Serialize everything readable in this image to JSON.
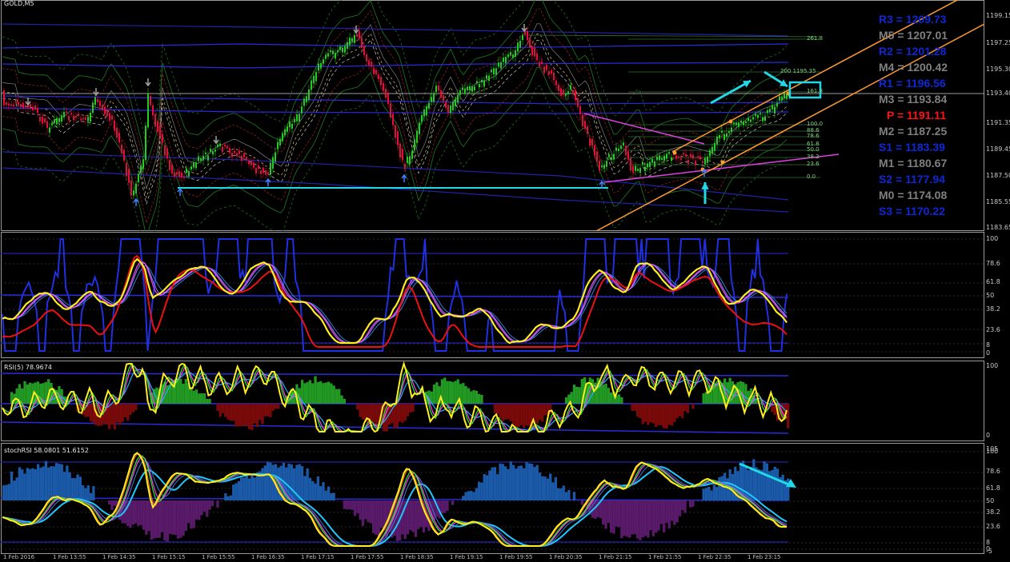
{
  "chart_title": "GOLD,M5",
  "main_panel": {
    "price_ticks": [
      "1199.15",
      "1197.25",
      "1195.30",
      "1193.40",
      "1191.35",
      "1189.45",
      "1187.50",
      "1185.55",
      "1183.65"
    ],
    "current_price": "1193.40",
    "fib_labels": [
      "261.8",
      "200  1195.35",
      "161.8",
      "100.0",
      "88.6",
      "78.6",
      "61.8",
      "50.0",
      "38.2",
      "23.6",
      "0.0"
    ]
  },
  "pivots": [
    {
      "key": "R3",
      "value": "1209.73",
      "kind": "R"
    },
    {
      "key": "M5",
      "value": "1207.01",
      "kind": "M"
    },
    {
      "key": "R2",
      "value": "1201.28",
      "kind": "R"
    },
    {
      "key": "M4",
      "value": "1200.42",
      "kind": "M"
    },
    {
      "key": "R1",
      "value": "1196.56",
      "kind": "R"
    },
    {
      "key": "M3",
      "value": "1193.84",
      "kind": "M"
    },
    {
      "key": "P",
      "value": "1191.11",
      "kind": "P"
    },
    {
      "key": "M2",
      "value": "1187.25",
      "kind": "M"
    },
    {
      "key": "S1",
      "value": "1183.39",
      "kind": "R"
    },
    {
      "key": "M1",
      "value": "1180.67",
      "kind": "M"
    },
    {
      "key": "S2",
      "value": "1177.94",
      "kind": "R"
    },
    {
      "key": "M0",
      "value": "1174.08",
      "kind": "M"
    },
    {
      "key": "S3",
      "value": "1170.22",
      "kind": "R"
    }
  ],
  "stoch_panel": {
    "ticks": [
      "100",
      "78.6",
      "61.8",
      "50",
      "38.2",
      "23.6",
      "8",
      "0"
    ]
  },
  "rsi_panel": {
    "label": "RSI(5) 78.9674",
    "ticks": [
      "100",
      "0"
    ]
  },
  "stochrsi_panel": {
    "label": "stochRSI 58.0801 51.6152",
    "ticks": [
      "105",
      "100",
      "78.6",
      "61.8",
      "50",
      "38.2",
      "23.6",
      "8",
      "0",
      "-5"
    ]
  },
  "x_ticks": [
    "1 Feb 2016",
    "1 Feb 13:55",
    "1 Feb 14:35",
    "1 Feb 15:15",
    "1 Feb 15:55",
    "1 Feb 16:35",
    "1 Feb 17:15",
    "1 Feb 17:55",
    "1 Feb 18:35",
    "1 Feb 19:15",
    "1 Feb 19:55",
    "1 Feb 20:35",
    "1 Feb 21:15",
    "1 Feb 21:55",
    "1 Feb 22:35",
    "1 Feb 23:15"
  ],
  "colors": {
    "bull": "#22cc22",
    "bear": "#e0103a",
    "pivot_r": "#0f28d6",
    "pivot_m": "#808080",
    "pivot_p": "#ff1010",
    "cyan": "#20d8e8",
    "orange": "#ff9a30",
    "magenta": "#e040e0",
    "yellow": "#ffee20"
  }
}
